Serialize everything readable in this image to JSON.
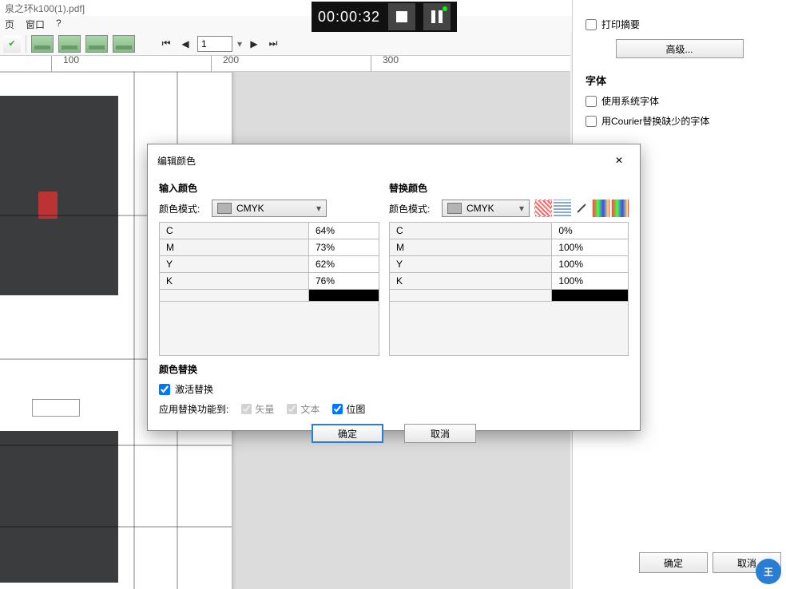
{
  "titlebar": {
    "filename": "泉之环k100(1).pdf]"
  },
  "menubar": {
    "item1": "页",
    "item2": "窗口",
    "item3": "?"
  },
  "toolbar": {
    "page_value": "1"
  },
  "ruler": {
    "m100": "100",
    "m200": "200",
    "m300": "300"
  },
  "recorder": {
    "time": "00:00:32"
  },
  "right_panel": {
    "print_summary": "打印摘要",
    "advanced_btn": "高级...",
    "font_header": "字体",
    "use_system_fonts": "使用系统字体",
    "replace_missing_courier": "用Courier替换缺少的字体",
    "ok": "确定",
    "cancel": "取消"
  },
  "dialog": {
    "title": "编辑颜色",
    "input_color": "输入颜色",
    "replace_color": "替换颜色",
    "mode_label": "颜色模式:",
    "cmyk": "CMYK",
    "input_rows": [
      {
        "ch": "C",
        "val": "64%"
      },
      {
        "ch": "M",
        "val": "73%"
      },
      {
        "ch": "Y",
        "val": "62%"
      },
      {
        "ch": "K",
        "val": "76%"
      }
    ],
    "replace_rows": [
      {
        "ch": "C",
        "val": "0%"
      },
      {
        "ch": "M",
        "val": "100%"
      },
      {
        "ch": "Y",
        "val": "100%"
      },
      {
        "ch": "K",
        "val": "100%"
      }
    ],
    "color_replace_header": "颜色替换",
    "activate_replace": "激活替换",
    "apply_to_label": "应用替换功能到:",
    "vector": "矢量",
    "text": "文本",
    "bitmap": "位图",
    "ok": "确定",
    "cancel": "取消"
  },
  "avatar": {
    "letter": "王"
  }
}
